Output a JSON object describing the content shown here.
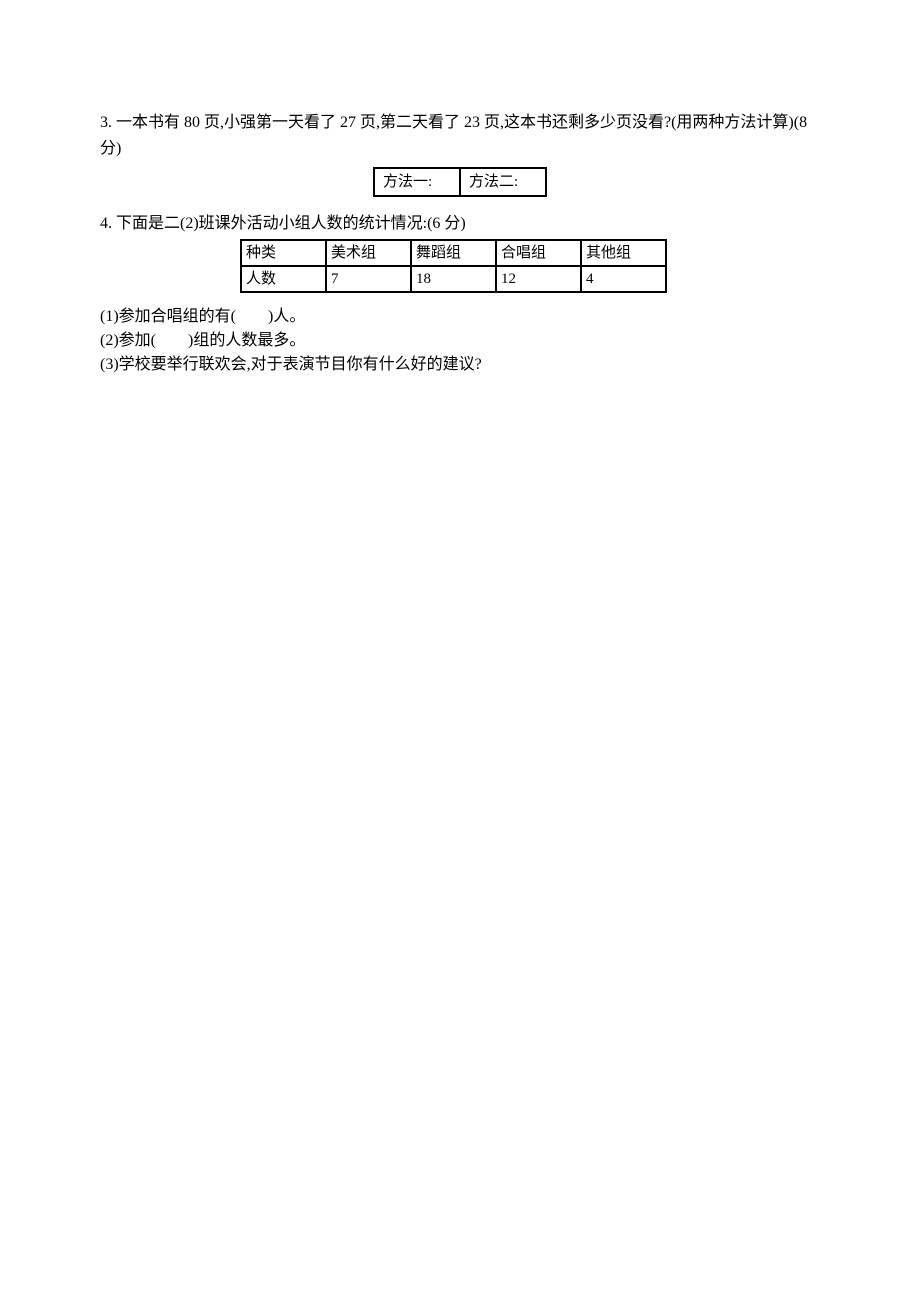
{
  "q3": {
    "number": "3.",
    "text": "一本书有 80 页,小强第一天看了 27 页,第二天看了 23 页,这本书还剩多少页没看?(用两种方法计算)(8 分)",
    "methods_table": {
      "cell1": "方法一:",
      "cell2": "方法二:"
    }
  },
  "q4": {
    "number": "4.",
    "text": "下面是二(2)班课外活动小组人数的统计情况:(6 分)",
    "table": {
      "header_row": [
        "种类",
        "美术组",
        "舞蹈组",
        "合唱组",
        "其他组"
      ],
      "data_row": [
        "人数",
        "7",
        "18",
        "12",
        "4"
      ]
    },
    "sub1": "(1)参加合唱组的有(  )人。",
    "sub2": "(2)参加(  )组的人数最多。",
    "sub3": "(3)学校要举行联欢会,对于表演节目你有什么好的建议?"
  },
  "chart_data": {
    "type": "table",
    "title": "二(2)班课外活动小组人数的统计情况",
    "categories": [
      "美术组",
      "舞蹈组",
      "合唱组",
      "其他组"
    ],
    "values": [
      7,
      18,
      12,
      4
    ],
    "xlabel": "种类",
    "ylabel": "人数"
  }
}
